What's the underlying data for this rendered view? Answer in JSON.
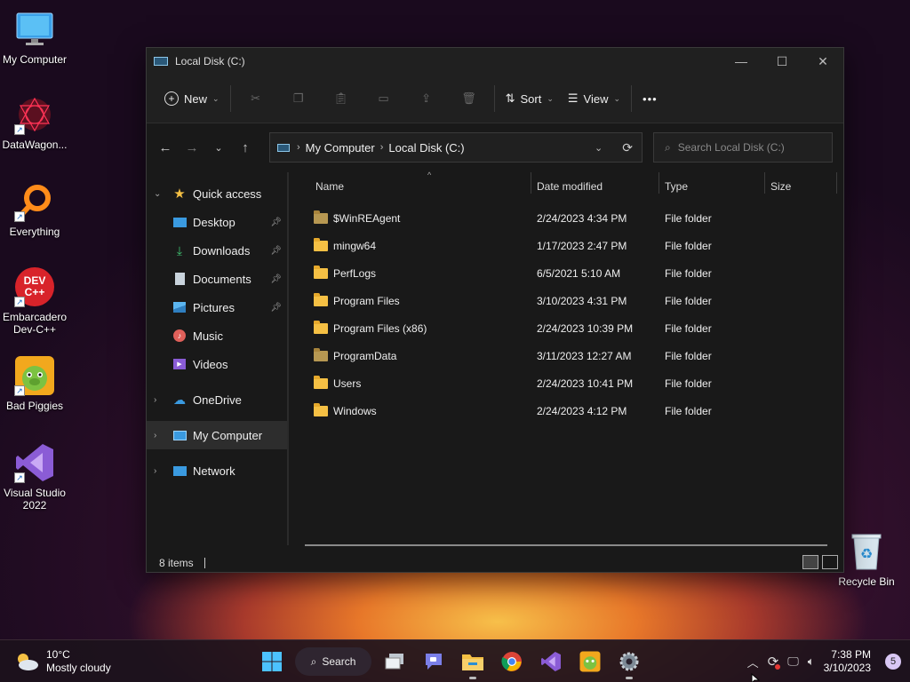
{
  "desktop": {
    "icons": [
      {
        "label": "My Computer",
        "icon": "monitor-icon"
      },
      {
        "label": "DataWagon...",
        "icon": "datawagon-icon"
      },
      {
        "label": "Everything",
        "icon": "everything-icon"
      },
      {
        "label": "Embarcadero Dev-C++",
        "icon": "devcpp-icon",
        "badge": "DEV C++"
      },
      {
        "label": "Bad Piggies",
        "icon": "bad-piggies-icon"
      },
      {
        "label": "Visual Studio 2022",
        "icon": "visual-studio-icon"
      },
      {
        "label": "Recycle Bin",
        "icon": "recycle-bin-icon"
      }
    ]
  },
  "window": {
    "title": "Local Disk (C:)",
    "controls": {
      "minimize": "—",
      "maximize": "☐",
      "close": "✕"
    }
  },
  "toolbar": {
    "new_label": "New",
    "sort_label": "Sort",
    "view_label": "View",
    "more_label": "•••",
    "accent": "#60cdff"
  },
  "address": {
    "crumbs": [
      "My Computer",
      "Local Disk (C:)"
    ],
    "search_placeholder": "Search Local Disk (C:)"
  },
  "sidebar": {
    "quick_access": "Quick access",
    "items": [
      "Desktop",
      "Downloads",
      "Documents",
      "Pictures",
      "Music",
      "Videos"
    ],
    "onedrive": "OneDrive",
    "my_computer": "My Computer",
    "network": "Network"
  },
  "columns": {
    "name": "Name",
    "date": "Date modified",
    "type": "Type",
    "size": "Size"
  },
  "files": [
    {
      "name": "$WinREAgent",
      "date": "2/24/2023 4:34 PM",
      "type": "File folder",
      "dim": true
    },
    {
      "name": "mingw64",
      "date": "1/17/2023 2:47 PM",
      "type": "File folder",
      "dim": false
    },
    {
      "name": "PerfLogs",
      "date": "6/5/2021 5:10 AM",
      "type": "File folder",
      "dim": false
    },
    {
      "name": "Program Files",
      "date": "3/10/2023 4:31 PM",
      "type": "File folder",
      "dim": false
    },
    {
      "name": "Program Files (x86)",
      "date": "2/24/2023 10:39 PM",
      "type": "File folder",
      "dim": false
    },
    {
      "name": "ProgramData",
      "date": "3/11/2023 12:27 AM",
      "type": "File folder",
      "dim": true
    },
    {
      "name": "Users",
      "date": "2/24/2023 10:41 PM",
      "type": "File folder",
      "dim": false
    },
    {
      "name": "Windows",
      "date": "2/24/2023 4:12 PM",
      "type": "File folder",
      "dim": false
    }
  ],
  "status": {
    "count": "8 items"
  },
  "taskbar": {
    "weather_temp": "10°C",
    "weather_desc": "Mostly cloudy",
    "search_label": "Search",
    "time": "7:38 PM",
    "date": "3/10/2023",
    "notifications": "5"
  }
}
